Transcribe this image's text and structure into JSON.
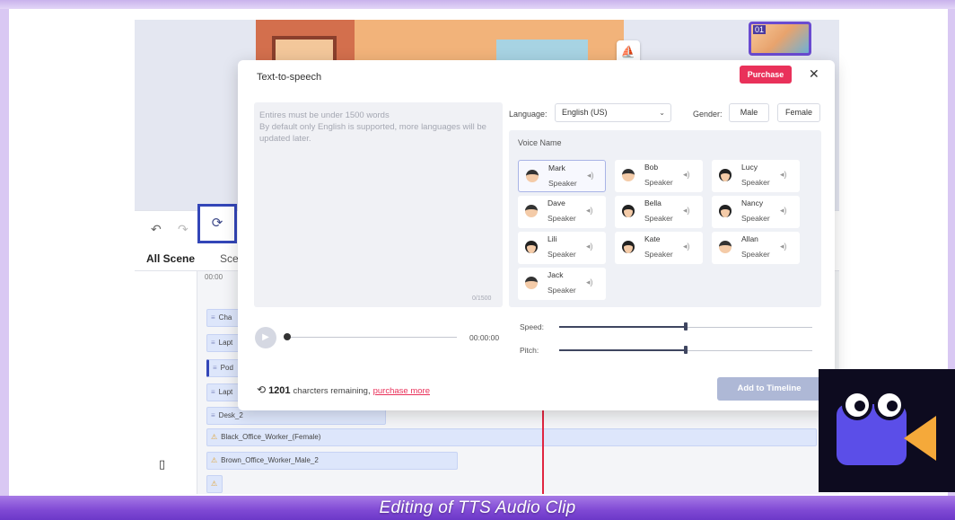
{
  "caption": "Editing of TTS Audio Clip",
  "editor": {
    "tabs": {
      "all_scene": "All Scene",
      "scene": "Sce"
    },
    "ruler_time": "00:00",
    "thumbnail_number": "01",
    "tracks": [
      {
        "label": "Cha"
      },
      {
        "label": "Lapt"
      },
      {
        "label": "Pod"
      },
      {
        "label": "Lapt"
      },
      {
        "label": "Desk_2"
      },
      {
        "label": "Black_Office_Worker_(Female)"
      },
      {
        "label": "Brown_Office_Worker_Male_2"
      },
      {
        "label": ""
      }
    ]
  },
  "modal": {
    "title": "Text-to-speech",
    "purchase_label": "Purchase",
    "close_label": "✕",
    "placeholder": "Entires must be under 1500 words\nBy default only English is supported, more languages will be updated later.",
    "char_count": "0/1500",
    "language_label": "Language:",
    "language_value": "English (US)",
    "gender_label": "Gender:",
    "gender_options": [
      "Male",
      "Female"
    ],
    "voice_name_label": "Voice Name",
    "voices": [
      {
        "name": "Mark",
        "role": "Speaker",
        "gender": "male",
        "selected": true
      },
      {
        "name": "Bob",
        "role": "Speaker",
        "gender": "male",
        "selected": false
      },
      {
        "name": "Lucy",
        "role": "Speaker",
        "gender": "female",
        "selected": false
      },
      {
        "name": "Dave",
        "role": "Speaker",
        "gender": "male",
        "selected": false
      },
      {
        "name": "Bella",
        "role": "Speaker",
        "gender": "female",
        "selected": false
      },
      {
        "name": "Nancy",
        "role": "Speaker",
        "gender": "female",
        "selected": false
      },
      {
        "name": "Lili",
        "role": "Speaker",
        "gender": "female",
        "selected": false
      },
      {
        "name": "Kate",
        "role": "Speaker",
        "gender": "female",
        "selected": false
      },
      {
        "name": "Allan",
        "role": "Speaker",
        "gender": "male",
        "selected": false
      },
      {
        "name": "Jack",
        "role": "Speaker",
        "gender": "male",
        "selected": false
      }
    ],
    "playback_time": "00:00:00",
    "speed_label": "Speed:",
    "pitch_label": "Pitch:",
    "speed_value": 0.5,
    "pitch_value": 0.5,
    "remaining_count": "1201",
    "remaining_text": "charcters remaining,",
    "purchase_more_link": "purchase more",
    "add_to_timeline_label": "Add to Timeline"
  },
  "colors": {
    "accent_pink": "#e9315a",
    "highlight_blue": "#3346b8",
    "logo_purple": "#5b4ee8",
    "logo_orange": "#f5a93a",
    "caption_band": "#7f49d4"
  }
}
